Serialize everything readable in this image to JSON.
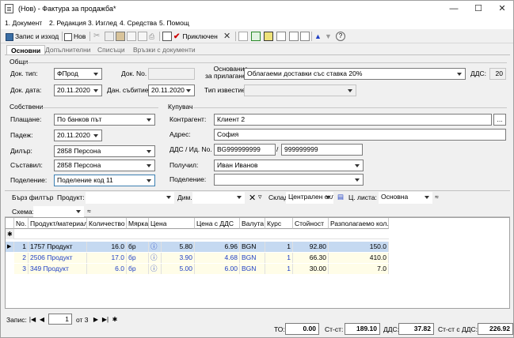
{
  "window": {
    "title": "(Нов) - Фактура за продажба*"
  },
  "menu": [
    "1. Документ",
    "2. Редакция",
    "3. Изглед",
    "4. Средства",
    "5. Помощ"
  ],
  "toolbar": {
    "save_exit": "Запис и изход",
    "new": "Нов",
    "close": "Приключен"
  },
  "tabs": [
    "Основни",
    "Допълнителни",
    "Списъци",
    "Връзки с документи"
  ],
  "general": {
    "section": "Общи",
    "doc_type_label": "Док. тип:",
    "doc_type": "ФПрод",
    "doc_no_label": "Док. No.",
    "doc_no": "",
    "doc_date_label": "Док. дата:",
    "doc_date": "20.11.2020",
    "event_date_label": "Дан. събитие:",
    "event_date": "20.11.2020",
    "basis_label": "Основание\nза прилагане:",
    "basis": "Облагаеми доставки със ставка 20%",
    "vat_label": "ДДС:",
    "vat": "20",
    "notice_label": "Тип известие:",
    "notice": ""
  },
  "own": {
    "section": "Собствени",
    "payment_label": "Плащане:",
    "payment": "По банков път",
    "due_label": "Падеж:",
    "due": "20.11.2020",
    "dealer_label": "Дилър:",
    "dealer": "2858 Персона",
    "author_label": "Съставил:",
    "author": "2858 Персона",
    "division_label": "Поделение:",
    "division": "Поделение код 11"
  },
  "buyer": {
    "section": "Купувач",
    "partner_label": "Контрагент:",
    "partner": "Клиент 2",
    "address_label": "Адрес:",
    "address": "София",
    "vat_label": "ДДС / Ид. No.",
    "vat_no": "BG999999999",
    "id_no": "999999999",
    "receiver_label": "Получил:",
    "receiver": "Иван Иванов",
    "division_label": "Поделение:",
    "division": ""
  },
  "filter": {
    "quick": "Бърз филтър",
    "product_label": "Продукт:",
    "product": "",
    "dim_label": "Дим.",
    "dim": "",
    "store_label": "Склад:",
    "store": "Централен скл",
    "price_list_label": "Ц. листа:",
    "price_list": "Основна",
    "scheme_label": "Схема:",
    "scheme": ""
  },
  "grid": {
    "headers": [
      "No.",
      "Продукт/материал",
      "Количество",
      "Мярка",
      "Цена",
      "Цена с ДДС",
      "Валута",
      "Курс",
      "Стойност",
      "Разполагаемо кол."
    ],
    "rows": [
      {
        "no": "1",
        "product": "1757 Продукт",
        "qty": "16.0",
        "unit": "бр",
        "price": "5.80",
        "price_vat": "6.96",
        "currency": "BGN",
        "rate": "1",
        "value": "92.80",
        "avail": "150.0"
      },
      {
        "no": "2",
        "product": "2506 Продукт",
        "qty": "17.0",
        "unit": "бр",
        "price": "3.90",
        "price_vat": "4.68",
        "currency": "BGN",
        "rate": "1",
        "value": "66.30",
        "avail": "410.0"
      },
      {
        "no": "3",
        "product": "349 Продукт",
        "qty": "6.0",
        "unit": "бр",
        "price": "5.00",
        "price_vat": "6.00",
        "currency": "BGN",
        "rate": "1",
        "value": "30.00",
        "avail": "7.0"
      }
    ]
  },
  "nav": {
    "label": "Запис:",
    "current": "1",
    "of": "от 3"
  },
  "totals": {
    "to_label": "ТО:",
    "to": "0.00",
    "st_label": "Ст-ст:",
    "st": "189.10",
    "vat_label": "ДДС:",
    "vat": "37.82",
    "st_vat_label": "Ст-ст с ДДС:",
    "st_vat": "226.92"
  },
  "colors": {
    "selected_row": "#c5d9f1",
    "accent": "#cc0000",
    "link_blue": "#1f3fc4"
  }
}
